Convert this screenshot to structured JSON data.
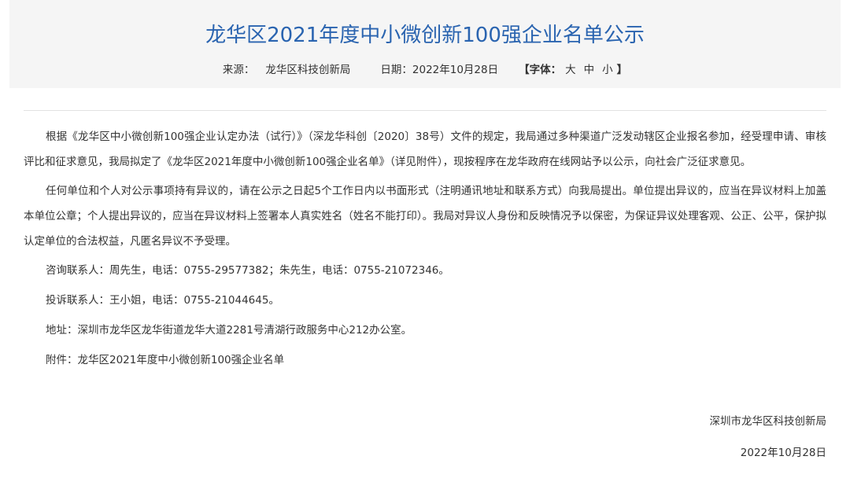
{
  "article": {
    "title": "龙华区2021年度中小微创新100强企业名单公示",
    "meta": {
      "source_label": "来源：",
      "source_value": "龙华区科技创新局",
      "date_label": "日期：",
      "date_value": "2022年10月28日",
      "font_open": "【字体：",
      "font_large": "大",
      "font_medium": "中",
      "font_small": "小",
      "font_close": "】"
    },
    "paragraphs": [
      "根据《龙华区中小微创新100强企业认定办法（试行）》（深龙华科创〔2020〕38号）文件的规定，我局通过多种渠道广泛发动辖区企业报名参加，经受理申请、审核评比和征求意见，我局拟定了《龙华区2021年度中小微创新100强企业名单》（详见附件），现按程序在龙华政府在线网站予以公示，向社会广泛征求意见。",
      "任何单位和个人对公示事项持有异议的，请在公示之日起5个工作日内以书面形式（注明通讯地址和联系方式）向我局提出。单位提出异议的，应当在异议材料上加盖本单位公章；个人提出异议的，应当在异议材料上签署本人真实姓名（姓名不能打印）。我局对异议人身份和反映情况予以保密，为保证异议处理客观、公正、公平，保护拟认定单位的合法权益，凡匿名异议不予受理。",
      "咨询联系人：周先生，电话：0755-29577382；朱先生，电话：0755-21072346。",
      "投诉联系人：王小姐，电话：0755-21044645。",
      "地址：深圳市龙华区龙华街道龙华大道2281号清湖行政服务中心212办公室。"
    ],
    "attachment": "附件：龙华区2021年度中小微创新100强企业名单",
    "signature": {
      "org": "深圳市龙华区科技创新局",
      "date": "2022年10月28日"
    }
  }
}
